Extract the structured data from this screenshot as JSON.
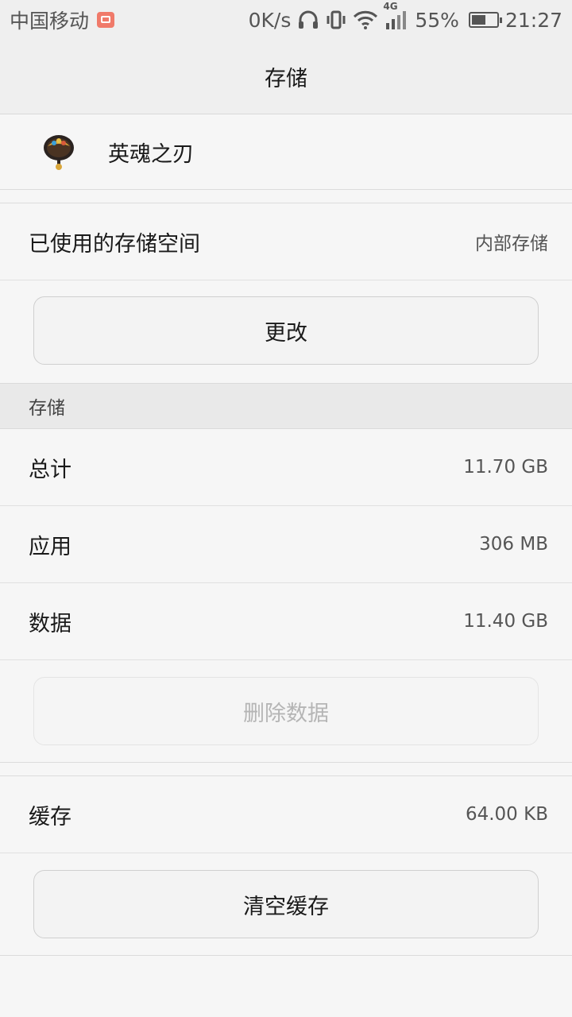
{
  "status_bar": {
    "carrier": "中国移动",
    "speed": "0K/s",
    "network_type": "4G",
    "battery_percent": "55%",
    "battery_level": 0.55,
    "time": "21:27",
    "icons": [
      "message-icon",
      "headphones-icon",
      "vibrate-icon",
      "wifi-icon",
      "signal-icon",
      "battery-icon"
    ]
  },
  "header": {
    "title": "存储"
  },
  "app": {
    "name": "英魂之刃",
    "icon": "app-icon"
  },
  "storage_used": {
    "label": "已使用的存储空间",
    "value": "内部存储"
  },
  "change_button": {
    "label": "更改"
  },
  "storage_section": {
    "title": "存储",
    "rows": [
      {
        "label": "总计",
        "value": "11.70 GB"
      },
      {
        "label": "应用",
        "value": "306 MB"
      },
      {
        "label": "数据",
        "value": "11.40 GB"
      }
    ]
  },
  "delete_data_button": {
    "label": "删除数据",
    "enabled": false
  },
  "cache": {
    "label": "缓存",
    "value": "64.00 KB"
  },
  "clear_cache_button": {
    "label": "清空缓存"
  },
  "colors": {
    "background": "#f6f6f6",
    "header_bg": "#efefef",
    "section_bg": "#e9e9e9",
    "disabled_text": "#b5b5b5"
  }
}
